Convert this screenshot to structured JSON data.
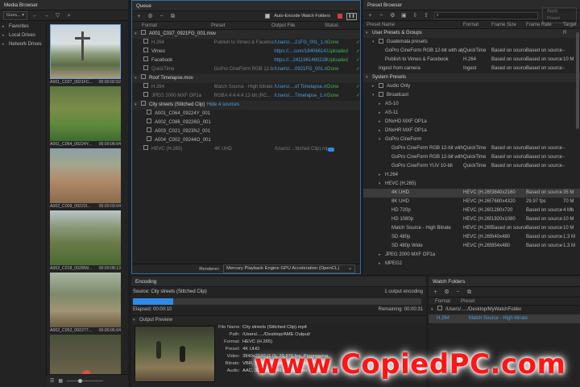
{
  "media_browser": {
    "title": "Media Browser",
    "location": "Gues...",
    "tree": [
      "Favorites",
      "Local Drives",
      "Network Drives"
    ],
    "thumbs": [
      {
        "name": "A001_C037_0921FC...",
        "dur": "00:00:02:02"
      },
      {
        "name": "A001_C064_09224Y...",
        "dur": "00:00:06:04"
      },
      {
        "name": "A002_C009_09222I...",
        "dur": "00:00:03:04"
      },
      {
        "name": "A002_C018_0928IW...",
        "dur": "00:00:08:13"
      },
      {
        "name": "A002_C052_092277...",
        "dur": "00:00:05:04"
      },
      {
        "name": "",
        "dur": ""
      }
    ]
  },
  "queue": {
    "title": "Queue",
    "auto_encode": "Auto-Encode Watch Folders",
    "columns": [
      "Format",
      "Preset",
      "Output File",
      "Status"
    ],
    "groups": [
      {
        "name": "A001_C037_0921FG_001.mov",
        "rows": [
          {
            "format": "H.264",
            "preset": "Publish to Vimeo & Facebook",
            "output": "/Users/....21FG_001_1.mp4",
            "status": "Done"
          },
          {
            "format": "Vimeo",
            "preset": "",
            "output": "https://....com/184066142",
            "status": "Uploaded"
          },
          {
            "format": "Facebook",
            "preset": "",
            "output": "https://...24119614602283",
            "status": "Uploaded"
          },
          {
            "format": "QuickTime",
            "preset": "GoPro CineForm RGB 12-bit with...",
            "output": "/Users/....0921FG_001.mov",
            "status": "Done"
          }
        ]
      },
      {
        "name": "Roof Timelapse.mov",
        "rows": [
          {
            "format": "H.264",
            "preset": "Match Source - High bitrate",
            "output": "/Users/....of Timelapse.mp4",
            "status": "Done"
          },
          {
            "format": "JPEG 2000 MXF OP1a",
            "preset": "RGBA 4:4:4:4 12-bit (RC...",
            "output": "/Users/....Timelapse_1.mxf",
            "status": "Done"
          }
        ]
      }
    ],
    "city": {
      "name": "City streets (Stitched Clip)",
      "hide": "Hide 4 sources",
      "sources": [
        "A001_C064_09224Y_001",
        "A002_C086_09226G_001",
        "A003_C021_0923NJ_001",
        "A004_C002_09244O_001"
      ],
      "row": {
        "format": "HEVC (H.265)",
        "preset": "4K UHD",
        "output": "/Users/....titched Clip).mp4"
      }
    },
    "renderer_label": "Renderer:",
    "renderer_value": "Mercury Playback Engine GPU Acceleration (OpenCL)"
  },
  "preset_browser": {
    "title": "Preset Browser",
    "apply": "Apply Preset",
    "columns": [
      "Preset Name",
      "Format",
      "Frame Size",
      "Frame Rate",
      "Target R"
    ],
    "rows": [
      {
        "indent": 0,
        "tri": "▾",
        "name": "User Presets & Groups",
        "format": "",
        "size": "",
        "rate": "",
        "tr": "",
        "hdr": true
      },
      {
        "indent": 1,
        "tri": "▾",
        "name": "Guatemala presets",
        "format": "",
        "size": "",
        "rate": "",
        "tr": "",
        "folder": true
      },
      {
        "indent": 2,
        "tri": "",
        "name": "GoPro CineForm RGB 12-bit with alpha (Max)",
        "format": "QuickTime",
        "size": "Based on source",
        "rate": "Based on source",
        "tr": "-"
      },
      {
        "indent": 2,
        "tri": "",
        "name": "Publish to Vimeo & Facebook",
        "format": "H.264",
        "size": "Based on source",
        "rate": "Based on source",
        "tr": "10 M"
      },
      {
        "indent": 1,
        "tri": "",
        "name": "Ingest from camera",
        "format": "Ingest",
        "size": "Based on source",
        "rate": "Based on source",
        "tr": "-"
      },
      {
        "indent": 0,
        "tri": "▾",
        "name": "System Presets",
        "format": "",
        "size": "",
        "rate": "",
        "tr": "",
        "hdr": true
      },
      {
        "indent": 1,
        "tri": "▸",
        "name": "Audio Only",
        "format": "",
        "size": "",
        "rate": "",
        "tr": "",
        "folder": true
      },
      {
        "indent": 1,
        "tri": "▾",
        "name": "Broadcast",
        "format": "",
        "size": "",
        "rate": "",
        "tr": "",
        "folder": true
      },
      {
        "indent": 2,
        "tri": "▸",
        "name": "AS-10",
        "format": "",
        "size": "",
        "rate": "",
        "tr": ""
      },
      {
        "indent": 2,
        "tri": "▸",
        "name": "AS-11",
        "format": "",
        "size": "",
        "rate": "",
        "tr": ""
      },
      {
        "indent": 2,
        "tri": "▸",
        "name": "DNxHD MXF OP1a",
        "format": "",
        "size": "",
        "rate": "",
        "tr": ""
      },
      {
        "indent": 2,
        "tri": "▸",
        "name": "DNxHR MXF OP1a",
        "format": "",
        "size": "",
        "rate": "",
        "tr": ""
      },
      {
        "indent": 2,
        "tri": "▾",
        "name": "GoPro CineForm",
        "format": "",
        "size": "",
        "rate": "",
        "tr": ""
      },
      {
        "indent": 3,
        "tri": "",
        "name": "GoPro CineForm RGB 12-bit with alpha",
        "format": "QuickTime",
        "size": "Based on source",
        "rate": "Based on source",
        "tr": "-"
      },
      {
        "indent": 3,
        "tri": "",
        "name": "GoPro CineForm RGB 12-bit with alpha",
        "format": "QuickTime",
        "size": "Based on source",
        "rate": "Based on source",
        "tr": "-"
      },
      {
        "indent": 3,
        "tri": "",
        "name": "GoPro CineForm YUV 10-bit",
        "format": "QuickTime",
        "size": "Based on source",
        "rate": "Based on source",
        "tr": "-"
      },
      {
        "indent": 2,
        "tri": "▸",
        "name": "H.264",
        "format": "",
        "size": "",
        "rate": "",
        "tr": ""
      },
      {
        "indent": 2,
        "tri": "▾",
        "name": "HEVC (H.265)",
        "format": "",
        "size": "",
        "rate": "",
        "tr": ""
      },
      {
        "indent": 3,
        "tri": "",
        "name": "4K UHD",
        "format": "HEVC (H.265)",
        "size": "3840x2160",
        "rate": "Based on source",
        "tr": "35 M",
        "sel": true
      },
      {
        "indent": 3,
        "tri": "",
        "name": "8K UHD",
        "format": "HEVC (H.265)",
        "size": "7680x4320",
        "rate": "29.97 fps",
        "tr": "70 M"
      },
      {
        "indent": 3,
        "tri": "",
        "name": "HD 720p",
        "format": "HEVC (H.265)",
        "size": "1280x720",
        "rate": "Based on source",
        "tr": "4 Mb"
      },
      {
        "indent": 3,
        "tri": "",
        "name": "HD 1080p",
        "format": "HEVC (H.265)",
        "size": "1920x1080",
        "rate": "Based on source",
        "tr": "10 M"
      },
      {
        "indent": 3,
        "tri": "",
        "name": "Match Source - High Bitrate",
        "format": "HEVC (H.265)",
        "size": "Based on source",
        "rate": "Based on source",
        "tr": "10 M"
      },
      {
        "indent": 3,
        "tri": "",
        "name": "SD 480p",
        "format": "HEVC (H.265)",
        "size": "640x480",
        "rate": "Based on source",
        "tr": "1.3 M"
      },
      {
        "indent": 3,
        "tri": "",
        "name": "SD 480p Wide",
        "format": "HEVC (H.265)",
        "size": "854x480",
        "rate": "Based on source",
        "tr": "1.3 M"
      },
      {
        "indent": 2,
        "tri": "▸",
        "name": "JPEG 2000 MXF OP1a",
        "format": "",
        "size": "",
        "rate": "",
        "tr": ""
      },
      {
        "indent": 2,
        "tri": "▸",
        "name": "MPEG2",
        "format": "",
        "size": "",
        "rate": "",
        "tr": ""
      }
    ]
  },
  "encoding": {
    "title": "Encoding",
    "source": "Source: City streets (Stitched Clip)",
    "outputs": "1 output encoding",
    "progress": 0.14,
    "elapsed": "Elapsed: 00:00:10",
    "remaining": "Remaining: 00:00:31",
    "preview_title": "Output Preview",
    "info": [
      {
        "k": "File Name:",
        "v": "City streets (Stitched Clip).mp4"
      },
      {
        "k": "Path:",
        "v": "/Users/...../Desktop/AME Output/"
      },
      {
        "k": "Format:",
        "v": "HEVC (H.265)"
      },
      {
        "k": "Preset:",
        "v": "4K UHD"
      },
      {
        "k": "Video:",
        "v": "3840x2160 (1.0), 29.976 fps, Progressive"
      },
      {
        "k": "Bitrate:",
        "v": "VBR, 1 pass, Target 35.00 Mbps"
      },
      {
        "k": "Audio:",
        "v": "AAC, 320 kbps, 48 kHz, Stereo"
      }
    ]
  },
  "watch": {
    "title": "Watch Folders",
    "columns": [
      "Format",
      "Preset"
    ],
    "folder": "/Users/...../Desktop/MyWatchFolder",
    "row": {
      "format": "H.264",
      "preset": "Match Source - High bitrate"
    }
  },
  "watermark": "www.CopiedPC.com",
  "colors": {
    "accent": "#2d8ceb",
    "link": "#4a9de0",
    "ok": "#3fb34f",
    "watermark": "#ff1515"
  }
}
